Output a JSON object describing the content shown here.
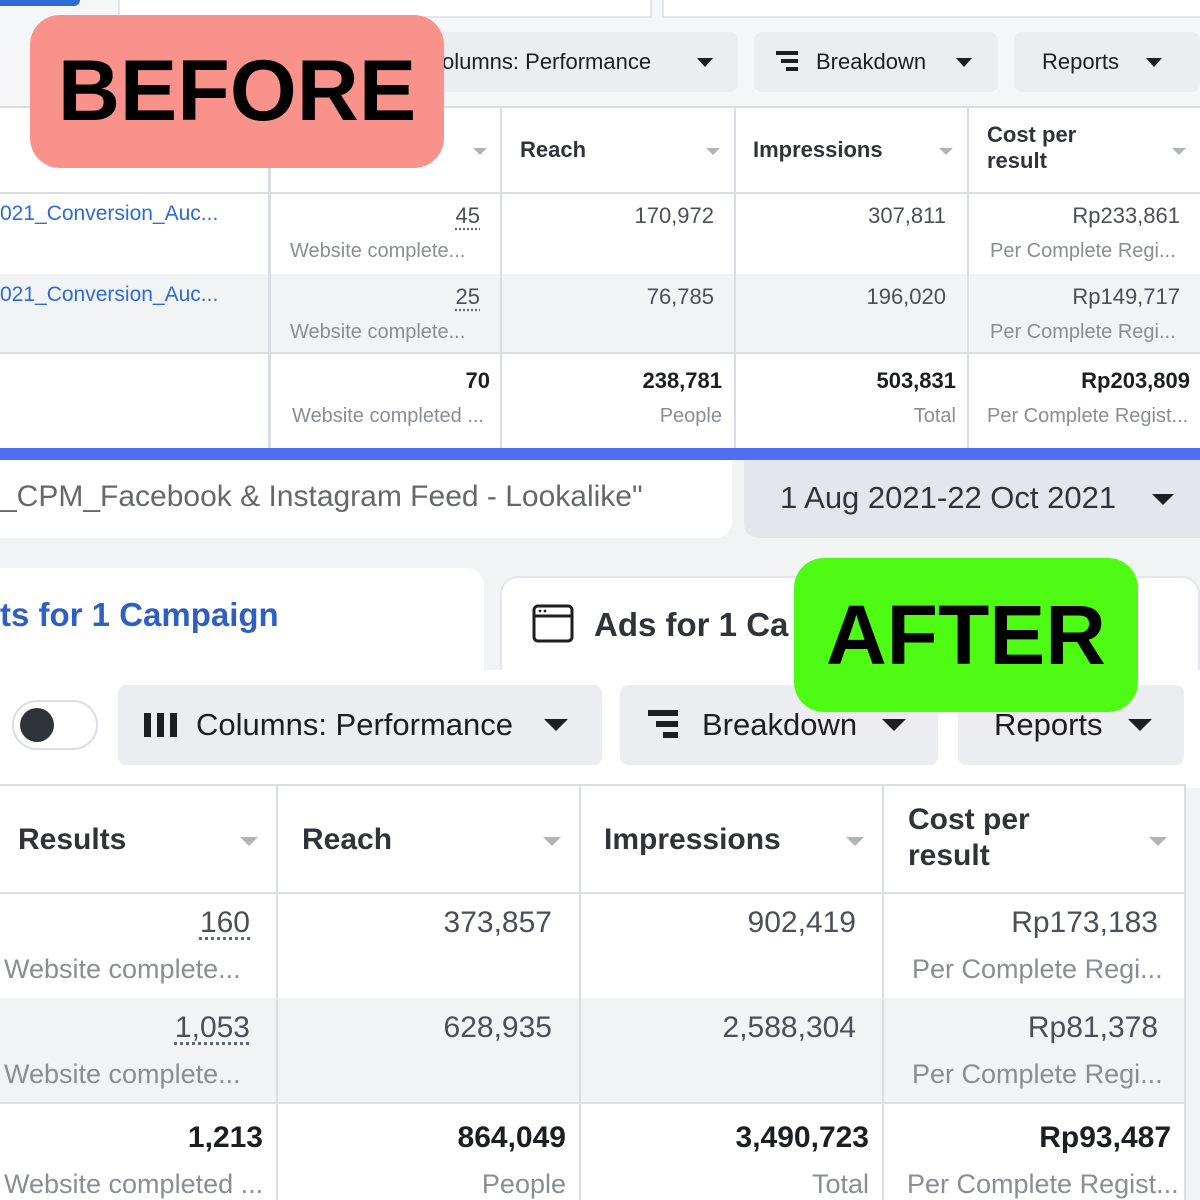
{
  "badges": {
    "before": "BEFORE",
    "after": "AFTER"
  },
  "before": {
    "toolbar": {
      "columns_label": "olumns: Performance",
      "breakdown_label": "Breakdown",
      "reports_label": "Reports"
    },
    "headers": {
      "reach": "Reach",
      "impressions": "Impressions",
      "cost_line1": "Cost per",
      "cost_line2": "result"
    },
    "rows": [
      {
        "campaign": "021_Conversion_Auc...",
        "results": "45",
        "results_sub": "Website complete...",
        "reach": "170,972",
        "impressions": "307,811",
        "cost": "Rp233,861",
        "cost_sub": "Per Complete Regi..."
      },
      {
        "campaign": "021_Conversion_Auc...",
        "results": "25",
        "results_sub": "Website complete...",
        "reach": "76,785",
        "impressions": "196,020",
        "cost": "Rp149,717",
        "cost_sub": "Per Complete Regi..."
      }
    ],
    "totals": {
      "results": "70",
      "results_sub": "Website completed ...",
      "reach": "238,781",
      "reach_sub": "People",
      "impressions": "503,831",
      "impressions_sub": "Total",
      "cost": "Rp203,809",
      "cost_sub": "Per Complete Regist..."
    }
  },
  "after": {
    "filter_text": "_CPM_Facebook & Instagram Feed - Lookalike\"",
    "date_range": "1 Aug 2021-22 Oct 2021",
    "tabs": {
      "ad_sets": "ts for 1 Campaign",
      "ads": "Ads for 1 Ca"
    },
    "toolbar": {
      "columns_label": "Columns: Performance",
      "breakdown_label": "Breakdown",
      "reports_label": "Reports"
    },
    "headers": {
      "results": "Results",
      "reach": "Reach",
      "impressions": "Impressions",
      "cost_line1": "Cost per",
      "cost_line2": "result"
    },
    "rows": [
      {
        "results": "160",
        "results_sub": "Website complete...",
        "reach": "373,857",
        "impressions": "902,419",
        "cost": "Rp173,183",
        "cost_sub": "Per Complete Regi..."
      },
      {
        "results": "1,053",
        "results_sub": "Website complete...",
        "reach": "628,935",
        "impressions": "2,588,304",
        "cost": "Rp81,378",
        "cost_sub": "Per Complete Regi..."
      }
    ],
    "totals": {
      "results": "1,213",
      "results_sub": "Website completed ...",
      "reach": "864,049",
      "reach_sub": "People",
      "impressions": "3,490,723",
      "impressions_sub": "Total",
      "cost": "Rp93,487",
      "cost_sub": "Per Complete Regist..."
    }
  },
  "colors": {
    "before_badge": "#f9928a",
    "after_badge": "#4dfc12",
    "divider": "#4f6ef2",
    "link": "#2f6bd6"
  },
  "icons": [
    "columns-icon",
    "breakdown-icon",
    "caret-down-icon",
    "toggle-switch",
    "ads-tab-icon"
  ]
}
